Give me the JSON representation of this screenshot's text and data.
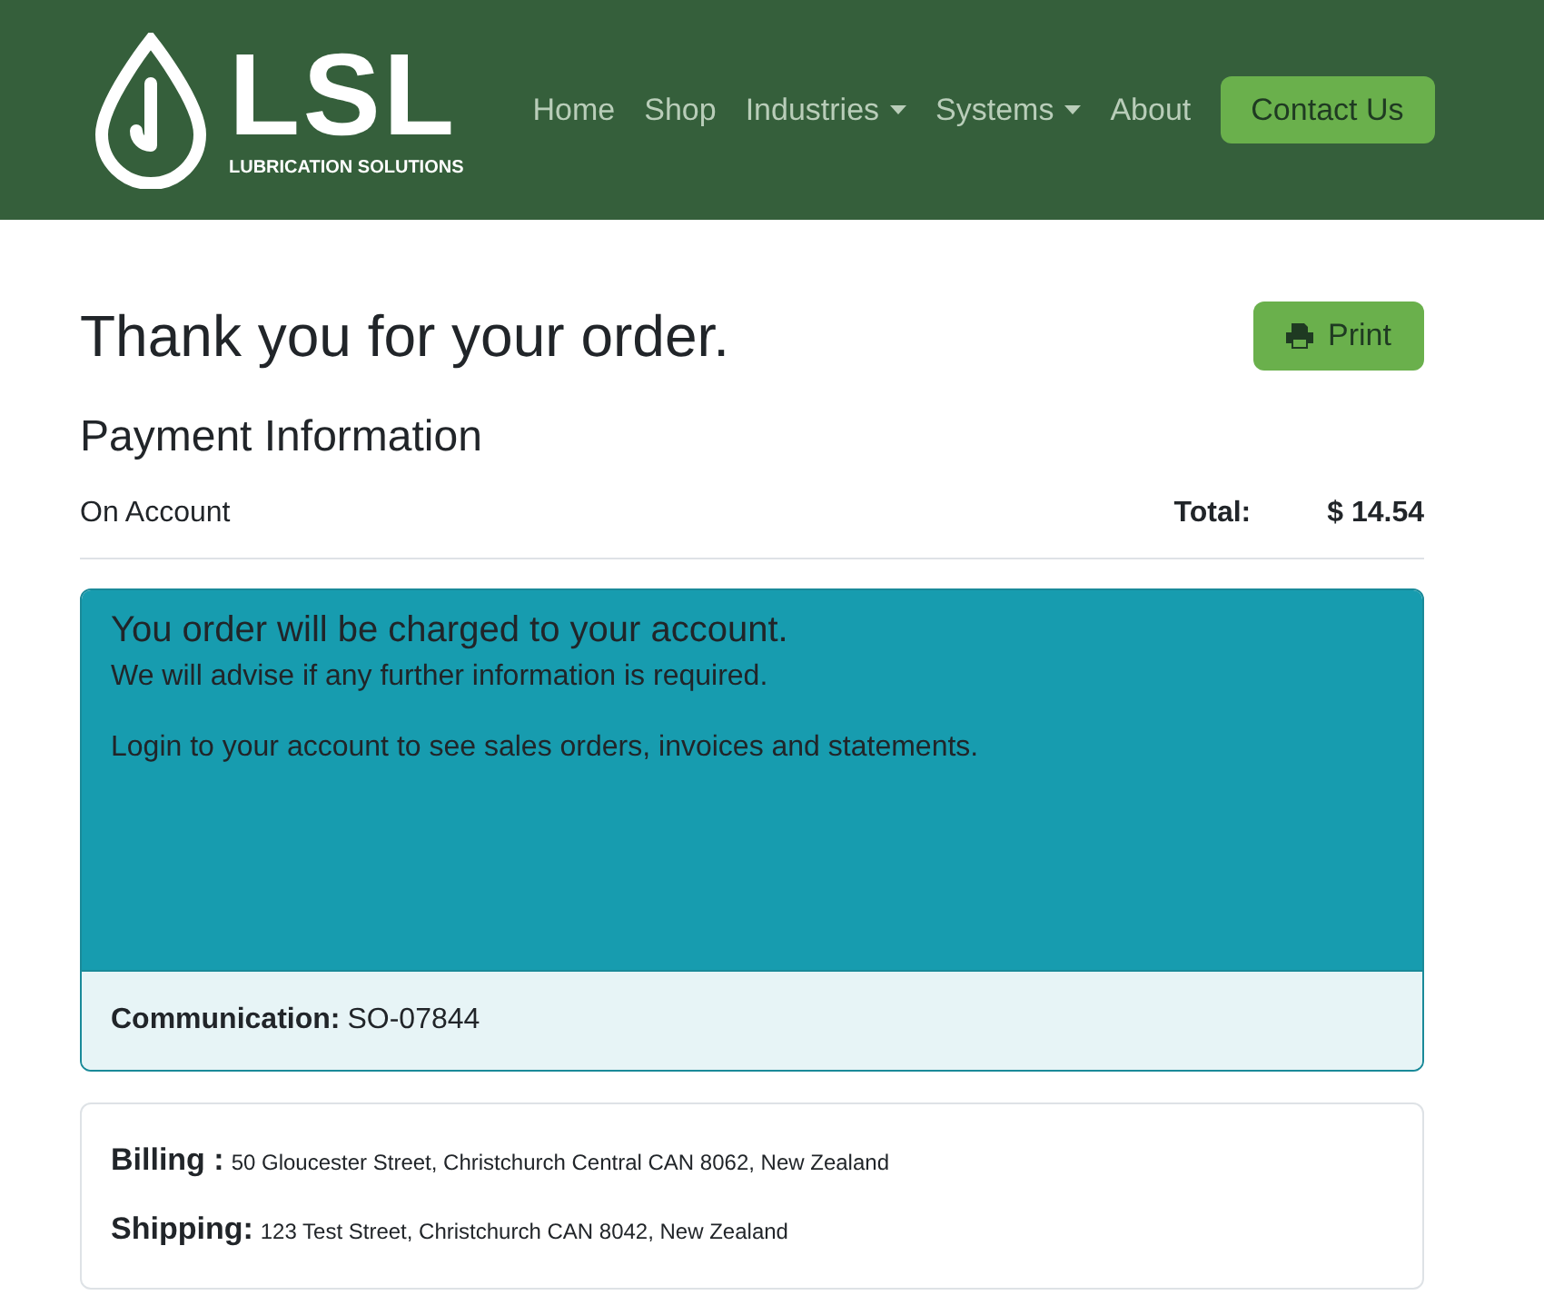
{
  "logo": {
    "mark": "LSL",
    "tagline": "LUBRICATION SOLUTIONS"
  },
  "nav": [
    {
      "label": "Home",
      "dropdown": false
    },
    {
      "label": "Shop",
      "dropdown": false
    },
    {
      "label": "Industries",
      "dropdown": true
    },
    {
      "label": "Systems",
      "dropdown": true
    },
    {
      "label": "About",
      "dropdown": false
    }
  ],
  "contact_button": "Contact Us",
  "heading": "Thank you for your order.",
  "print_button": "Print",
  "payment": {
    "title": "Payment Information",
    "method": "On Account",
    "total_label": "Total:",
    "total": "$ 14.54"
  },
  "notice": {
    "title": "You order will be charged to your account.",
    "lines": [
      "We will advise if any further information is required.",
      "Login to your account to see sales orders, invoices and statements."
    ],
    "footer_label": "Communication:",
    "footer_value": "SO-07844"
  },
  "addresses": [
    {
      "label": "Billing :",
      "value": "50 Gloucester Street, Christchurch Central CAN 8062, New Zealand"
    },
    {
      "label": "Shipping:",
      "value": "123 Test Street, Christchurch CAN 8042, New Zealand"
    }
  ]
}
